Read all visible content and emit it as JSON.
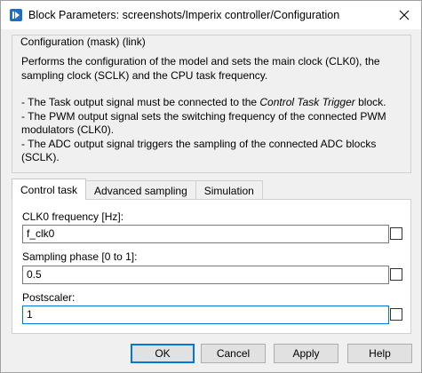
{
  "window": {
    "title": "Block Parameters: screenshots/Imperix controller/Configuration"
  },
  "description": {
    "group_title": "Configuration (mask) (link)",
    "lines": [
      "Performs the configuration of the model and sets the main clock (CLK0), the sampling clock (SCLK) and the CPU task frequency.",
      "- The Task output signal must be connected to the ",
      "Control Task Trigger",
      " block.",
      "- The PWM output signal sets the switching frequency of the connected PWM modulators (CLK0).",
      "- The ADC output signal triggers the sampling of the connected ADC blocks (SCLK)."
    ]
  },
  "tabs": [
    {
      "label": "Control task",
      "active": true
    },
    {
      "label": "Advanced sampling",
      "active": false
    },
    {
      "label": "Simulation",
      "active": false
    }
  ],
  "fields": [
    {
      "label": "CLK0 frequency [Hz]:",
      "value": "f_clk0",
      "checked": false
    },
    {
      "label": "Sampling phase [0 to 1]:",
      "value": "0.5",
      "checked": false
    },
    {
      "label": "Postscaler:",
      "value": "1",
      "checked": false
    }
  ],
  "buttons": {
    "ok": "OK",
    "cancel": "Cancel",
    "apply": "Apply",
    "help": "Help"
  },
  "colors": {
    "accent": "#0078d7",
    "icon": "#1e6fc3"
  },
  "icons": {
    "app": "simulink-block-icon",
    "close": "close-icon"
  }
}
